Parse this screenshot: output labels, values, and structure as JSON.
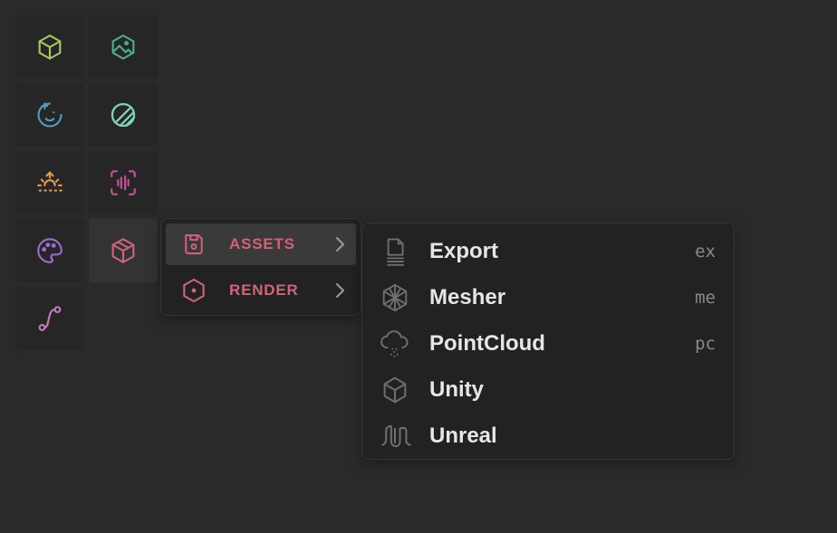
{
  "toolbar": {
    "tools": [
      {
        "name": "cube-tool",
        "icon": "cube-icon",
        "color": "#a6c860"
      },
      {
        "name": "image-tool",
        "icon": "photo-hexagon-icon",
        "color": "#4fae8a"
      },
      {
        "name": "sticker-tool",
        "icon": "mood-plus-icon",
        "color": "#4f9cbc"
      },
      {
        "name": "brand-tool",
        "icon": "slashed-circle-icon",
        "color": "#7fd6b6"
      },
      {
        "name": "sunrise-tool",
        "icon": "sunrise-icon",
        "color": "#e09a52"
      },
      {
        "name": "audio-tool",
        "icon": "voice-scan-icon",
        "color": "#c24f9a"
      },
      {
        "name": "palette-tool",
        "icon": "palette-icon",
        "color": "#9c6ad0"
      },
      {
        "name": "package-tool",
        "icon": "package-icon",
        "color": "#d0627a"
      },
      {
        "name": "route-tool",
        "icon": "route-icon",
        "color": "#c07ab8"
      }
    ]
  },
  "context_menu": {
    "accent_color": "#d0627a",
    "items": [
      {
        "label": "ASSETS",
        "icon": "device-floppy-icon",
        "highlighted": true
      },
      {
        "label": "RENDER",
        "icon": "hexagon-dot-icon",
        "highlighted": false
      }
    ]
  },
  "submenu": {
    "items": [
      {
        "label": "Export",
        "shortcut": "ex",
        "icon": "file-export-icon"
      },
      {
        "label": "Mesher",
        "shortcut": "me",
        "icon": "mesh-sphere-icon"
      },
      {
        "label": "PointCloud",
        "shortcut": "pc",
        "icon": "cloud-points-icon"
      },
      {
        "label": "Unity",
        "shortcut": "",
        "icon": "unity-logo-icon"
      },
      {
        "label": "Unreal",
        "shortcut": "",
        "icon": "unreal-logo-icon"
      }
    ]
  }
}
